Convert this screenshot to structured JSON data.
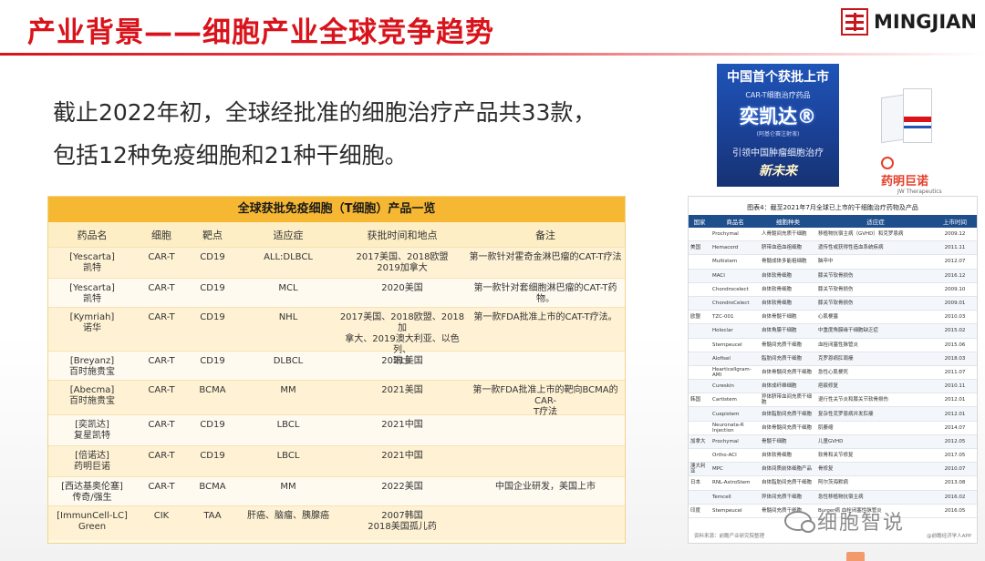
{
  "header": {
    "title": "产业背景——细胞产业全球竞争趋势",
    "logo_text": "MINGJIAN"
  },
  "intro": {
    "line1": "截止2022年初，全球经批准的细胞治疗产品共33款，",
    "line2": "包括12种免疫细胞和21种干细胞。"
  },
  "ad": {
    "headline": "中国首个获批上市",
    "subtitle": "CAR-T细胞治疗药品",
    "brand": "奕凯达®",
    "brand_note": "(阿基仑赛注射液)",
    "slogan": "引领中国肿瘤细胞治疗",
    "slogan2": "新未来",
    "company": "药明巨诺",
    "company_en": "JW Therapeutics"
  },
  "table1": {
    "title": "全球获批免疫细胞（T细胞）产品一览",
    "headers": [
      "药品名",
      "细胞",
      "靶点",
      "适应症",
      "获批时间和地点",
      "备注"
    ],
    "rows": [
      {
        "drug": "[Yescarta]\n凯特",
        "cell": "CAR-T",
        "target": "CD19",
        "indication": "ALL:DLBCL",
        "approval": "2017美国、2018欧盟\n2019加拿大",
        "note": "第一款针对霍奇金淋巴瘤的CAT-T疗法"
      },
      {
        "drug": "[Yescarta]\n凯特",
        "cell": "CAR-T",
        "target": "CD19",
        "indication": "MCL",
        "approval": "2020美国",
        "note": "第一款针对套细胞淋巴瘤的CAT-T药物。"
      },
      {
        "drug": "[Kymriah]\n诺华",
        "cell": "CAR-T",
        "target": "CD19",
        "indication": "NHL",
        "approval": "2017美国、2018欧盟、2018加\n拿大、2019澳大利亚、以色列、\n瑞士",
        "note": "第一款FDA批准上市的CAT-T疗法。"
      },
      {
        "drug": "[Breyanz]\n百时施贵宝",
        "cell": "CAR-T",
        "target": "CD19",
        "indication": "DLBCL",
        "approval": "2021美国",
        "note": ""
      },
      {
        "drug": "[Abecma]\n百时施贵宝",
        "cell": "CAR-T",
        "target": "BCMA",
        "indication": "MM",
        "approval": "2021美国",
        "note": "第一款FDA批准上市的靶向BCMA的CAR-\nT疗法"
      },
      {
        "drug": "[奕凯达]\n复星凯特",
        "cell": "CAR-T",
        "target": "CD19",
        "indication": "LBCL",
        "approval": "2021中国",
        "note": ""
      },
      {
        "drug": "[倍诺达]\n药明巨诺",
        "cell": "CAR-T",
        "target": "CD19",
        "indication": "LBCL",
        "approval": "2021中国",
        "note": ""
      },
      {
        "drug": "[西达基奥伦塞]\n传奇/强生",
        "cell": "CAR-T",
        "target": "BCMA",
        "indication": "MM",
        "approval": "2022美国",
        "note": "中国企业研发，美国上市"
      },
      {
        "drug": "[ImmunCell-LC]\nGreen",
        "cell": "CIK",
        "target": "TAA",
        "indication": "肝癌、脑瘤、胰腺癌",
        "approval": "2007韩国\n2018美国孤儿药",
        "note": ""
      }
    ]
  },
  "table2": {
    "caption": "图表4：截至2021年7月全球已上市的干细胞治疗药物及产品",
    "headers": [
      "国家",
      "商品名",
      "细胞种类",
      "适应症",
      "上市时间"
    ],
    "rows": [
      {
        "country": "",
        "name": "Prochymal",
        "cell": "人骨髓间充质干细胞",
        "ind": "移植物抗宿主病（GVHD）和克罗恩病",
        "year": "2009.12"
      },
      {
        "country": "美国",
        "name": "Hemacord",
        "cell": "脐带血造血祖细胞",
        "ind": "遗传性或获得性造血系统疾病",
        "year": "2011.11"
      },
      {
        "country": "",
        "name": "Multistem",
        "cell": "骨髓成体多能祖细胞",
        "ind": "脑卒中",
        "year": "2012.07"
      },
      {
        "country": "",
        "name": "MACI",
        "cell": "自体软骨细胞",
        "ind": "膝关节软骨损伤",
        "year": "2016.12"
      },
      {
        "country": "",
        "name": "Chondrocelect",
        "cell": "自体软骨细胞",
        "ind": "膝关节软骨损伤",
        "year": "2009.10"
      },
      {
        "country": "",
        "name": "ChondroCelect",
        "cell": "自体软骨细胞",
        "ind": "膝关节软骨损伤",
        "year": "2009.01"
      },
      {
        "country": "欧盟",
        "name": "TZC-001",
        "cell": "自体骨髓干细胞",
        "ind": "心肌梗塞",
        "year": "2010.03"
      },
      {
        "country": "",
        "name": "Holoclar",
        "cell": "自体角膜干细胞",
        "ind": "中重度角膜缘干细胞缺乏症",
        "year": "2015.02"
      },
      {
        "country": "",
        "name": "Stempeucel",
        "cell": "骨髓间充质干细胞",
        "ind": "血栓闭塞性脉管炎",
        "year": "2015.06"
      },
      {
        "country": "",
        "name": "Alofisel",
        "cell": "脂肪间充质干细胞",
        "ind": "克罗恩病肛周瘘",
        "year": "2018.03"
      },
      {
        "country": "",
        "name": "Hearticellgram-AMI",
        "cell": "自体骨髓间充质干细胞",
        "ind": "急性心肌梗死",
        "year": "2011.07"
      },
      {
        "country": "",
        "name": "Cureskin",
        "cell": "自体成纤维细胞",
        "ind": "疤痕修复",
        "year": "2010.11"
      },
      {
        "country": "韩国",
        "name": "Cartistem",
        "cell": "异体脐带血间充质干细胞",
        "ind": "退行性关节炎和膝关节软骨损伤",
        "year": "2012.01"
      },
      {
        "country": "",
        "name": "Cuepistem",
        "cell": "自体脂肪间充质干细胞",
        "ind": "复杂性克罗恩病并发肛瘘",
        "year": "2012.01"
      },
      {
        "country": "",
        "name": "Neuronata-R Injection",
        "cell": "自体骨髓间充质干细胞",
        "ind": "肌萎缩",
        "year": "2014.07"
      },
      {
        "country": "加拿大",
        "name": "Prochymal",
        "cell": "骨髓干细胞",
        "ind": "儿童GVHD",
        "year": "2012.05"
      },
      {
        "country": "",
        "name": "Ortho-ACI",
        "cell": "自体软骨细胞",
        "ind": "软骨和关节修复",
        "year": "2017.05"
      },
      {
        "country": "澳大利亚",
        "name": "MPC",
        "cell": "自体间质前体细胞产品",
        "ind": "骨修复",
        "year": "2010.07"
      },
      {
        "country": "日本",
        "name": "RNL-AstroStem",
        "cell": "自体脂肪间充质干细胞",
        "ind": "阿尔茨海默病",
        "year": "2013.08"
      },
      {
        "country": "",
        "name": "Temcell",
        "cell": "异体间充质干细胞",
        "ind": "急性移植物抗宿主病",
        "year": "2016.02"
      },
      {
        "country": "印度",
        "name": "Stempeucel",
        "cell": "骨髓间充质干细胞",
        "ind": "Burger病 血栓闭塞性脉管炎",
        "year": "2016.05"
      }
    ],
    "footer_left": "资料来源：前瞻产业研究院整理",
    "footer_right": "@前瞻经济学人APP"
  },
  "watermark": {
    "text": "细胞智说"
  }
}
